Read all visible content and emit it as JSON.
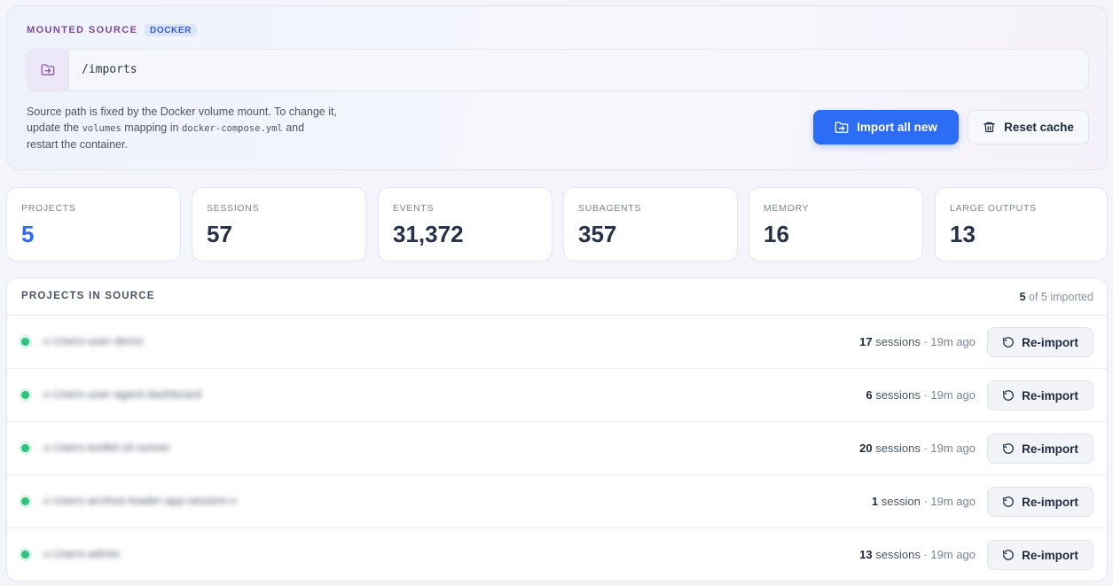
{
  "source": {
    "title": "MOUNTED SOURCE",
    "badge": "DOCKER",
    "path": "/imports",
    "note_part1": "Source path is fixed by the Docker volume mount. To change it, update the ",
    "note_code1": "volumes",
    "note_part2": " mapping in ",
    "note_code2": "docker-compose.yml",
    "note_part3": " and restart the container.",
    "import_button": "Import all new",
    "reset_button": "Reset cache",
    "icons": {
      "path": "folder-import-icon",
      "import": "folder-import-icon",
      "reset": "trash-icon"
    },
    "colors": {
      "primary": "#2d6cf4",
      "title": "#7b4a9b"
    }
  },
  "stats": [
    {
      "label": "PROJECTS",
      "value": "5",
      "accent": true
    },
    {
      "label": "SESSIONS",
      "value": "57"
    },
    {
      "label": "EVENTS",
      "value": "31,372"
    },
    {
      "label": "SUBAGENTS",
      "value": "357"
    },
    {
      "label": "MEMORY",
      "value": "16"
    },
    {
      "label": "LARGE OUTPUTS",
      "value": "13"
    }
  ],
  "projects": {
    "title": "PROJECTS IN SOURCE",
    "imported_count": "5",
    "imported_rest": " of 5 imported",
    "status_color": "#2ec27e",
    "reimport_label": "Re-import",
    "rows": [
      {
        "name": "-c-Users-user-demo",
        "count": "17",
        "unit": "sessions",
        "ago": " · 19m ago"
      },
      {
        "name": "-c-Users-user-agent-dashboard",
        "count": "6",
        "unit": "sessions",
        "ago": " · 19m ago"
      },
      {
        "name": "-c-Users-toolkit-cli-runner",
        "count": "20",
        "unit": "sessions",
        "ago": " · 19m ago"
      },
      {
        "name": "-c-Users-archive-loader-app-session-v",
        "count": "1",
        "unit": "session",
        "ago": " · 19m ago"
      },
      {
        "name": "-c-Users-admin",
        "count": "13",
        "unit": "sessions",
        "ago": " · 19m ago"
      }
    ]
  }
}
